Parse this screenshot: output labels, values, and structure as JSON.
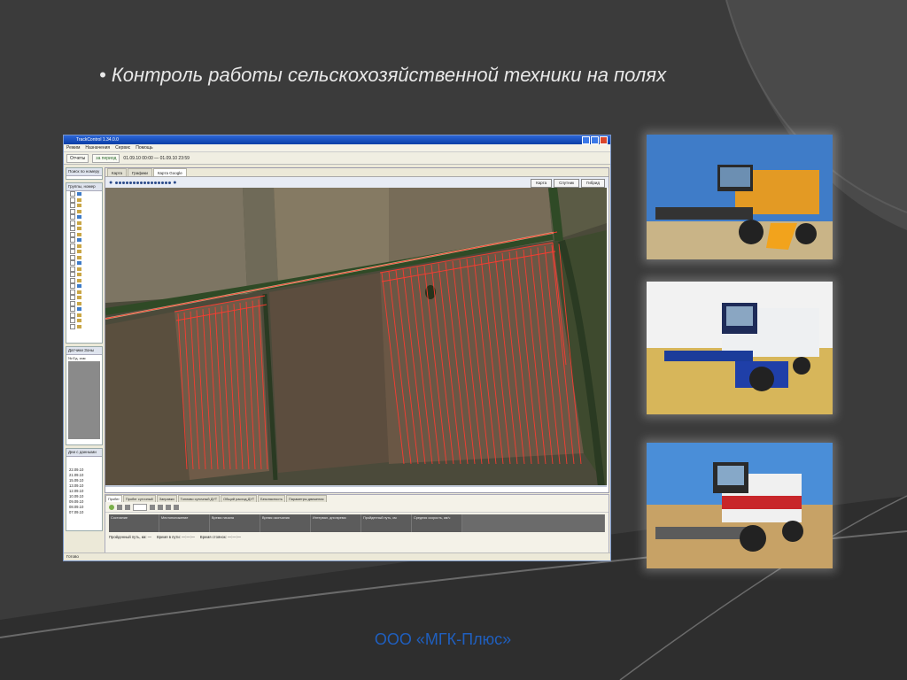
{
  "slide": {
    "title": "• Контроль работы сельскохозяйственной техники на полях",
    "footer": "ООО «МГК-Плюс»"
  },
  "app": {
    "window_title": "TrackControl 1.34.0.0",
    "menu": [
      "Режим",
      "Назначения",
      "Сервис",
      "Помощь"
    ],
    "toolbar": {
      "reports_label": "Отчеты",
      "period_label": "за период",
      "date_range": "01.09.10 00:00 — 01.09.10 23:59"
    },
    "left": {
      "search_label": "Поиск по номеру",
      "groups_label": "Группы, номер",
      "col_all": "Все",
      "sensors_tab": "Датчики",
      "sensors_tab2": "Зоны",
      "sensor_cols": [
        "№",
        "Ед. изм"
      ],
      "days_label": "Дни с данными",
      "dates": [
        "22.09.10",
        "21.09.10",
        "15.09.10",
        "13.09.10",
        "12.09.10",
        "10.09.10",
        "09.09.10",
        "08.09.10",
        "07.09.10"
      ]
    },
    "map": {
      "tabs": [
        "Карта",
        "Графики",
        "Карта Google"
      ],
      "map_types": [
        "Карта",
        "Спутник",
        "Гибрид"
      ]
    },
    "bottom": {
      "tabs": [
        "Пробег",
        "Пробег суточный",
        "Заправки",
        "Топливо суточный ДУТ",
        "Общий расход ДУТ",
        "Безопасность",
        "Параметры движения"
      ],
      "headers": [
        "Состояние",
        "Местоположение",
        "Время начала",
        "Время окончания",
        "Интервал, дни:время",
        "Пройденный путь, км",
        "Средняя скорость, км/ч"
      ],
      "summary": [
        "Пройденный путь, км: —",
        "Время в пути: —:—:—",
        "Время стоянок: —:—:—"
      ]
    },
    "status": "Готово"
  },
  "colors": {
    "track": "#ff3b30",
    "footer": "#1f5fbf",
    "bg": "#3a3a3a"
  }
}
